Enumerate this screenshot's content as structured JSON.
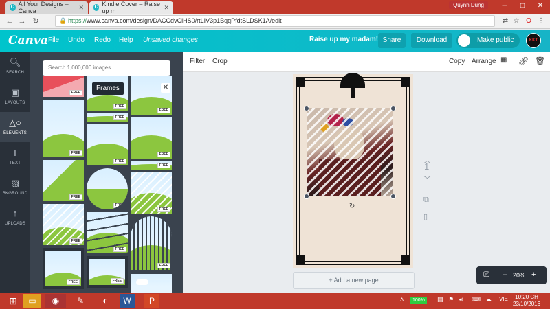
{
  "browser": {
    "tabs": [
      {
        "label": "All Your Designs – Canva",
        "favicon": "C"
      },
      {
        "label": "Kindle Cover – Raise up m",
        "favicon": "C"
      }
    ],
    "profile_name": "Quynh Dung",
    "url_prefix": "https://",
    "url": "www.canva.com/design/DACCdvClHS0/rtLIV3p1BqqPfdtSLDSK1A/edit"
  },
  "header": {
    "logo": "Canva",
    "menu": [
      "File",
      "Undo",
      "Redo",
      "Help"
    ],
    "status": "Unsaved changes",
    "title": "Raise up my madam!",
    "share_label": "Share",
    "download_label": "Download",
    "public_label": "Make public",
    "avatar_text": "KKT"
  },
  "rail": {
    "items": [
      {
        "label": "SEARCH",
        "icon": "search-icon"
      },
      {
        "label": "LAYOUTS",
        "icon": "layouts-icon"
      },
      {
        "label": "ELEMENTS",
        "icon": "elements-icon"
      },
      {
        "label": "TEXT",
        "icon": "text-icon"
      },
      {
        "label": "BKGROUND",
        "icon": "background-icon"
      },
      {
        "label": "UPLOADS",
        "icon": "uploads-icon"
      }
    ]
  },
  "panel": {
    "search_placeholder": "Search 1,000,000 images...",
    "category": "Frames",
    "free_badge": "FREE"
  },
  "toolbar": {
    "filter": "Filter",
    "crop": "Crop",
    "copy": "Copy",
    "arrange": "Arrange"
  },
  "editor": {
    "page_number": "1",
    "add_page": "+ Add a new page",
    "zoom": "20%",
    "zoom_minus": "–",
    "zoom_plus": "+"
  },
  "taskbar": {
    "battery": "100%",
    "lang": "VIE",
    "time": "10:20 CH",
    "date": "23/10/2016"
  }
}
